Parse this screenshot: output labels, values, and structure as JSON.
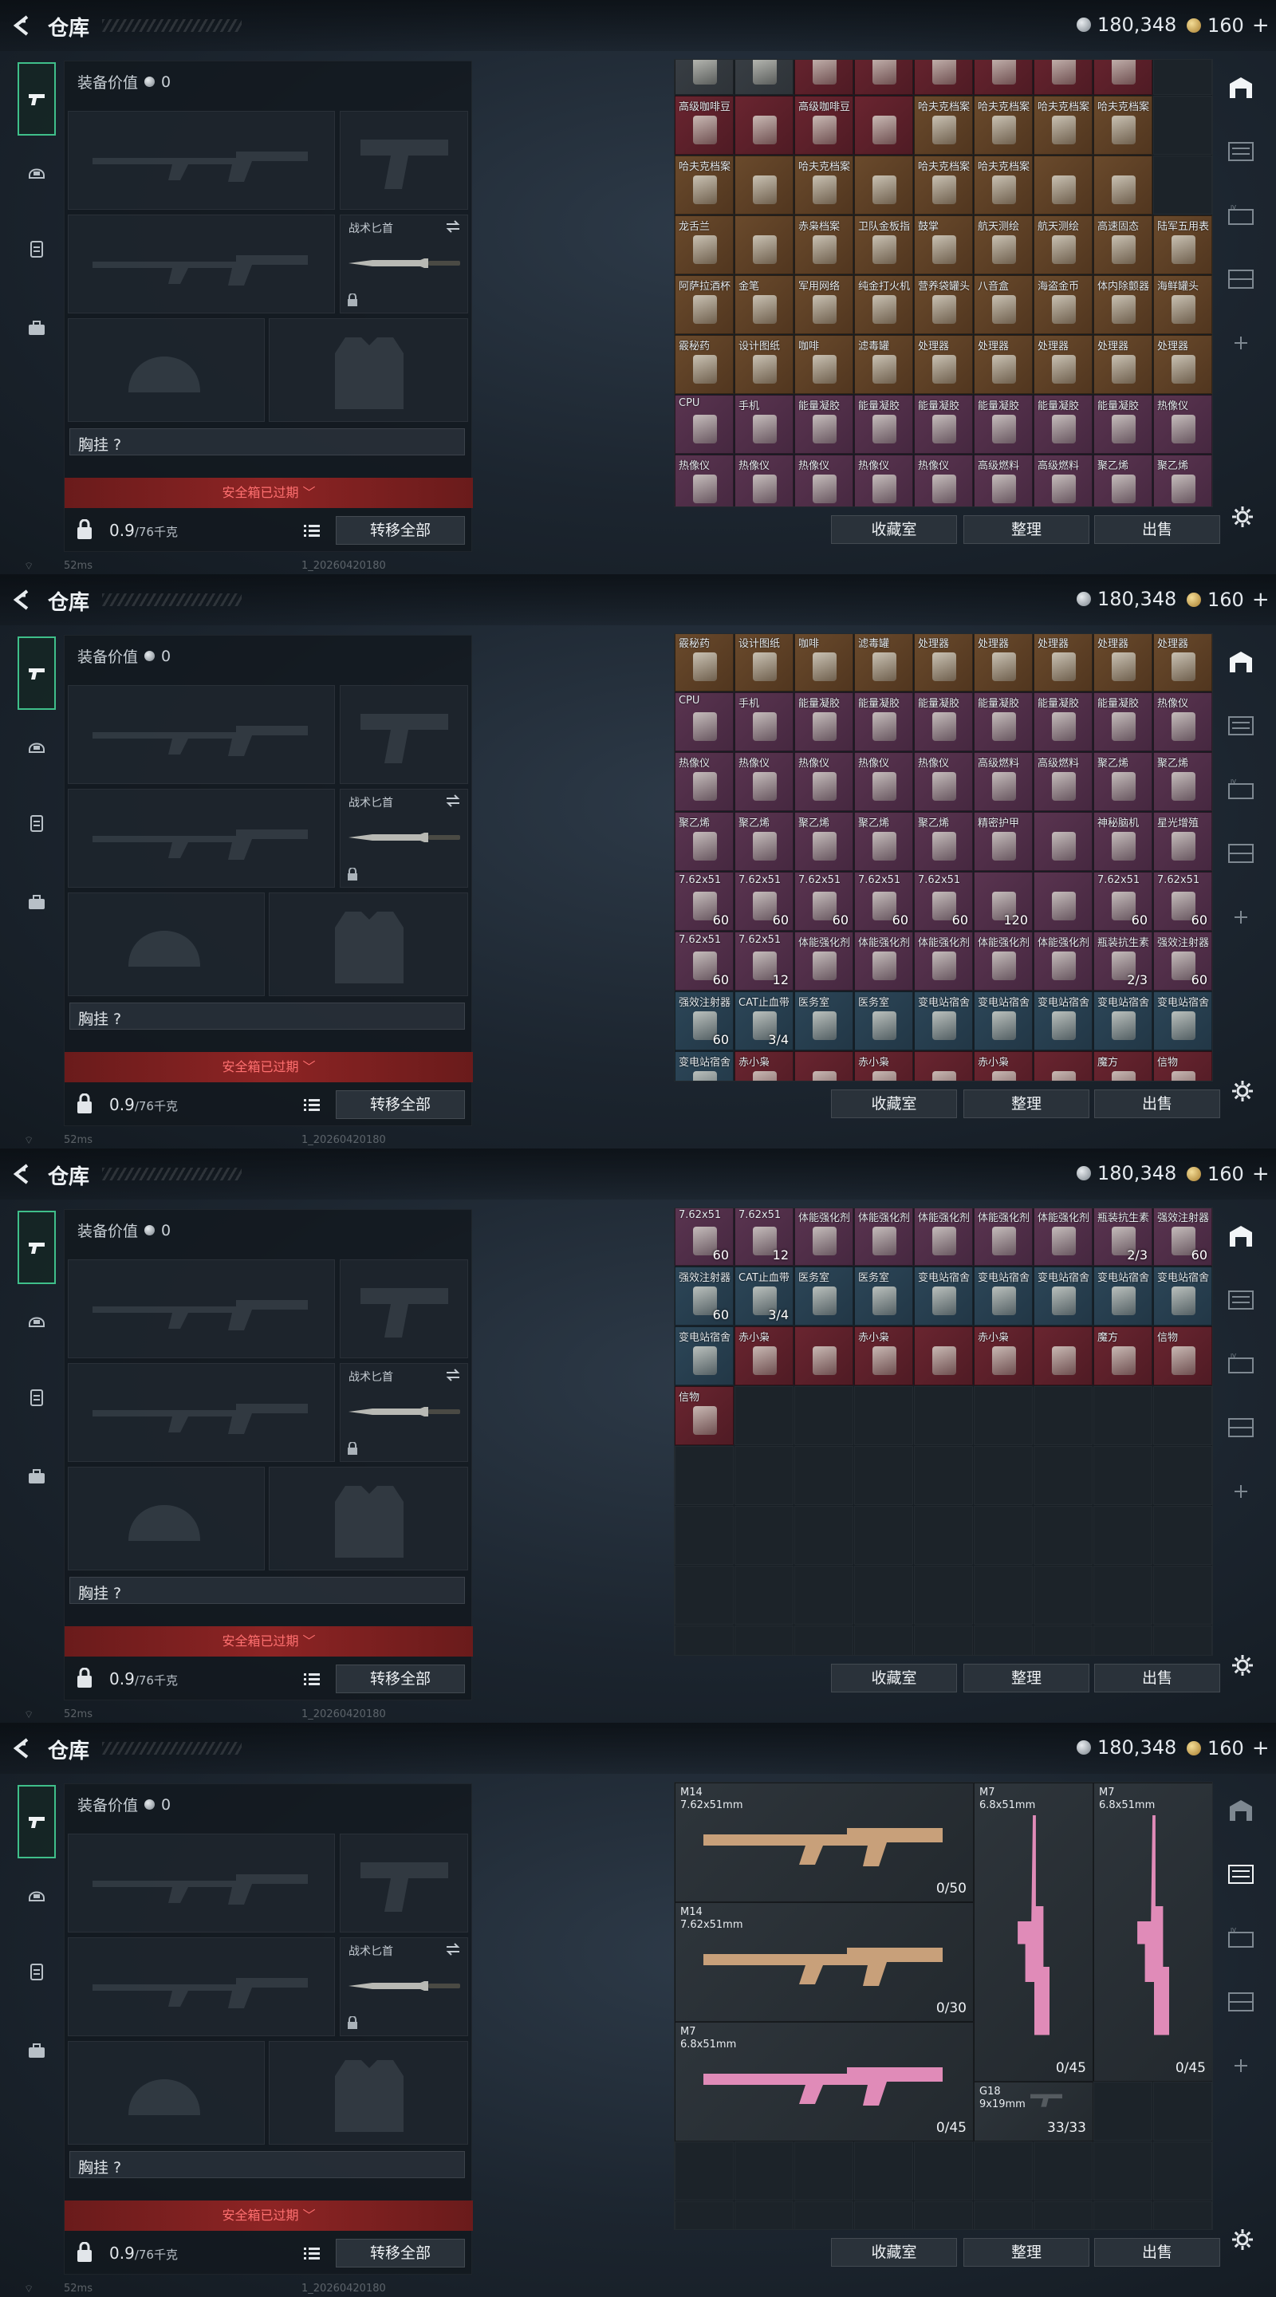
{
  "header": {
    "title": "仓库",
    "silver": "180,348",
    "gold": "160",
    "plus": "+"
  },
  "equipment": {
    "value_label": "装备价值",
    "value": "0",
    "knife_label": "战术匕首",
    "chest_label": "胸挂 ?",
    "safebox_expired": "安全箱已过期",
    "weight": "0.9",
    "weight_cap": "/76千克",
    "transfer_all": "转移全部"
  },
  "actions": {
    "collection": "收藏室",
    "organize": "整理",
    "sell": "出售"
  },
  "status_bar": {
    "ping": "52ms",
    "build": "1_20260420180"
  },
  "panel1_rows": [
    [
      {
        "l": "",
        "r": "grey"
      },
      {
        "l": "",
        "r": "grey"
      },
      {
        "l": "",
        "r": "red"
      },
      {
        "l": "",
        "r": "red"
      },
      {
        "l": "",
        "r": "red"
      },
      {
        "l": "",
        "r": "red"
      },
      {
        "l": "",
        "r": "red"
      },
      {
        "l": "",
        "r": "red"
      }
    ],
    [
      {
        "l": "高级咖啡豆",
        "r": "red"
      },
      {
        "l": "",
        "r": "red"
      },
      {
        "l": "高级咖啡豆",
        "r": "red"
      },
      {
        "l": "",
        "r": "red"
      },
      {
        "l": "哈夫克档案",
        "r": "orange"
      },
      {
        "l": "哈夫克档案",
        "r": "orange"
      },
      {
        "l": "哈夫克档案",
        "r": "orange"
      },
      {
        "l": "哈夫克档案",
        "r": "orange"
      }
    ],
    [
      {
        "l": "哈夫克档案",
        "r": "orange"
      },
      {
        "l": "",
        "r": "orange"
      },
      {
        "l": "哈夫克档案",
        "r": "orange"
      },
      {
        "l": "",
        "r": "orange"
      },
      {
        "l": "哈夫克档案",
        "r": "orange"
      },
      {
        "l": "哈夫克档案",
        "r": "orange"
      },
      {
        "l": "",
        "r": "orange"
      },
      {
        "l": "",
        "r": "orange"
      }
    ],
    [
      {
        "l": "龙舌兰",
        "r": "orange"
      },
      {
        "l": "",
        "r": "orange"
      },
      {
        "l": "赤枭档案",
        "r": "orange"
      },
      {
        "l": "卫队金板指",
        "r": "orange"
      },
      {
        "l": "鼓掌",
        "r": "orange"
      },
      {
        "l": "航天测绘",
        "r": "orange"
      },
      {
        "l": "航天测绘",
        "r": "orange"
      },
      {
        "l": "高速固态",
        "r": "orange"
      },
      {
        "l": "陆军五用表",
        "r": "orange"
      }
    ],
    [
      {
        "l": "阿萨拉酒杯",
        "r": "orange"
      },
      {
        "l": "金笔",
        "r": "orange"
      },
      {
        "l": "军用网络",
        "r": "orange"
      },
      {
        "l": "纯金打火机",
        "r": "orange"
      },
      {
        "l": "营养袋罐头",
        "r": "orange"
      },
      {
        "l": "八音盒",
        "r": "orange"
      },
      {
        "l": "海盗金币",
        "r": "orange"
      },
      {
        "l": "体内除颤器",
        "r": "orange"
      },
      {
        "l": "海鲜罐头",
        "r": "orange"
      }
    ],
    [
      {
        "l": "霰秘药",
        "r": "orange"
      },
      {
        "l": "设计图纸",
        "r": "orange"
      },
      {
        "l": "咖啡",
        "r": "orange"
      },
      {
        "l": "滤毒罐",
        "r": "orange"
      },
      {
        "l": "处理器",
        "r": "orange"
      },
      {
        "l": "处理器",
        "r": "orange"
      },
      {
        "l": "处理器",
        "r": "orange"
      },
      {
        "l": "处理器",
        "r": "orange"
      },
      {
        "l": "处理器",
        "r": "orange"
      }
    ],
    [
      {
        "l": "CPU",
        "r": "purple"
      },
      {
        "l": "手机",
        "r": "purple"
      },
      {
        "l": "能量凝胶",
        "r": "purple"
      },
      {
        "l": "能量凝胶",
        "r": "purple"
      },
      {
        "l": "能量凝胶",
        "r": "purple"
      },
      {
        "l": "能量凝胶",
        "r": "purple"
      },
      {
        "l": "能量凝胶",
        "r": "purple"
      },
      {
        "l": "能量凝胶",
        "r": "purple"
      },
      {
        "l": "热像仪",
        "r": "purple"
      }
    ],
    [
      {
        "l": "热像仪",
        "r": "purple"
      },
      {
        "l": "热像仪",
        "r": "purple"
      },
      {
        "l": "热像仪",
        "r": "purple"
      },
      {
        "l": "热像仪",
        "r": "purple"
      },
      {
        "l": "热像仪",
        "r": "purple"
      },
      {
        "l": "高级燃料",
        "r": "purple"
      },
      {
        "l": "高级燃料",
        "r": "purple"
      },
      {
        "l": "聚乙烯",
        "r": "purple"
      },
      {
        "l": "聚乙烯",
        "r": "purple"
      }
    ]
  ],
  "panel2_rows": [
    [
      {
        "l": "霰秘药",
        "r": "orange"
      },
      {
        "l": "设计图纸",
        "r": "orange"
      },
      {
        "l": "咖啡",
        "r": "orange"
      },
      {
        "l": "滤毒罐",
        "r": "orange"
      },
      {
        "l": "处理器",
        "r": "orange"
      },
      {
        "l": "处理器",
        "r": "orange"
      },
      {
        "l": "处理器",
        "r": "orange"
      },
      {
        "l": "处理器",
        "r": "orange"
      },
      {
        "l": "处理器",
        "r": "orange"
      }
    ],
    [
      {
        "l": "CPU",
        "r": "purple"
      },
      {
        "l": "手机",
        "r": "purple"
      },
      {
        "l": "能量凝胶",
        "r": "purple"
      },
      {
        "l": "能量凝胶",
        "r": "purple"
      },
      {
        "l": "能量凝胶",
        "r": "purple"
      },
      {
        "l": "能量凝胶",
        "r": "purple"
      },
      {
        "l": "能量凝胶",
        "r": "purple"
      },
      {
        "l": "能量凝胶",
        "r": "purple"
      },
      {
        "l": "热像仪",
        "r": "purple"
      }
    ],
    [
      {
        "l": "热像仪",
        "r": "purple"
      },
      {
        "l": "热像仪",
        "r": "purple"
      },
      {
        "l": "热像仪",
        "r": "purple"
      },
      {
        "l": "热像仪",
        "r": "purple"
      },
      {
        "l": "热像仪",
        "r": "purple"
      },
      {
        "l": "高级燃料",
        "r": "purple"
      },
      {
        "l": "高级燃料",
        "r": "purple"
      },
      {
        "l": "聚乙烯",
        "r": "purple"
      },
      {
        "l": "聚乙烯",
        "r": "purple"
      }
    ],
    [
      {
        "l": "聚乙烯",
        "r": "purple"
      },
      {
        "l": "聚乙烯",
        "r": "purple"
      },
      {
        "l": "聚乙烯",
        "r": "purple"
      },
      {
        "l": "聚乙烯",
        "r": "purple"
      },
      {
        "l": "聚乙烯",
        "r": "purple"
      },
      {
        "l": "精密护甲",
        "r": "purple"
      },
      {
        "l": "",
        "r": "purple"
      },
      {
        "l": "神秘脑机",
        "r": "purple"
      },
      {
        "l": "星光增殖",
        "r": "purple"
      }
    ],
    [
      {
        "l": "7.62x51",
        "r": "purple",
        "q": "60"
      },
      {
        "l": "7.62x51",
        "r": "purple",
        "q": "60"
      },
      {
        "l": "7.62x51",
        "r": "purple",
        "q": "60"
      },
      {
        "l": "7.62x51",
        "r": "purple",
        "q": "60"
      },
      {
        "l": "7.62x51",
        "r": "purple",
        "q": "60"
      },
      {
        "l": "",
        "r": "purple",
        "q": "120"
      },
      {
        "l": "",
        "r": "purple"
      },
      {
        "l": "7.62x51",
        "r": "purple",
        "q": "60"
      },
      {
        "l": "7.62x51",
        "r": "purple",
        "q": "60"
      }
    ],
    [
      {
        "l": "7.62x51",
        "r": "purple",
        "q": "60"
      },
      {
        "l": "7.62x51",
        "r": "purple",
        "q": "12"
      },
      {
        "l": "体能强化剂",
        "r": "purple"
      },
      {
        "l": "体能强化剂",
        "r": "purple"
      },
      {
        "l": "体能强化剂",
        "r": "purple"
      },
      {
        "l": "体能强化剂",
        "r": "purple"
      },
      {
        "l": "体能强化剂",
        "r": "purple"
      },
      {
        "l": "瓶装抗生素",
        "r": "purple",
        "q": "2/3"
      },
      {
        "l": "强效注射器",
        "r": "purple",
        "q": "60"
      }
    ],
    [
      {
        "l": "强效注射器",
        "r": "blue",
        "q": "60"
      },
      {
        "l": "CAT止血带",
        "r": "blue",
        "q": "3/4"
      },
      {
        "l": "医务室",
        "r": "blue"
      },
      {
        "l": "医务室",
        "r": "blue"
      },
      {
        "l": "变电站宿舍",
        "r": "blue"
      },
      {
        "l": "变电站宿舍",
        "r": "blue"
      },
      {
        "l": "变电站宿舍",
        "r": "blue"
      },
      {
        "l": "变电站宿舍",
        "r": "blue"
      },
      {
        "l": "变电站宿舍",
        "r": "blue"
      }
    ],
    [
      {
        "l": "变电站宿舍",
        "r": "blue"
      },
      {
        "l": "赤小枭",
        "r": "red"
      },
      {
        "l": "",
        "r": "red"
      },
      {
        "l": "赤小枭",
        "r": "red"
      },
      {
        "l": "",
        "r": "red"
      },
      {
        "l": "赤小枭",
        "r": "red"
      },
      {
        "l": "",
        "r": "red"
      },
      {
        "l": "魔方",
        "r": "red"
      },
      {
        "l": "信物",
        "r": "red"
      }
    ]
  ],
  "panel3_rows": [
    [
      {
        "l": "7.62x51",
        "r": "purple",
        "q": "60"
      },
      {
        "l": "7.62x51",
        "r": "purple",
        "q": "12"
      },
      {
        "l": "体能强化剂",
        "r": "purple"
      },
      {
        "l": "体能强化剂",
        "r": "purple"
      },
      {
        "l": "体能强化剂",
        "r": "purple"
      },
      {
        "l": "体能强化剂",
        "r": "purple"
      },
      {
        "l": "体能强化剂",
        "r": "purple"
      },
      {
        "l": "瓶装抗生素",
        "r": "purple",
        "q": "2/3"
      },
      {
        "l": "强效注射器",
        "r": "purple",
        "q": "60"
      }
    ],
    [
      {
        "l": "强效注射器",
        "r": "blue",
        "q": "60"
      },
      {
        "l": "CAT止血带",
        "r": "blue",
        "q": "3/4"
      },
      {
        "l": "医务室",
        "r": "blue"
      },
      {
        "l": "医务室",
        "r": "blue"
      },
      {
        "l": "变电站宿舍",
        "r": "blue"
      },
      {
        "l": "变电站宿舍",
        "r": "blue"
      },
      {
        "l": "变电站宿舍",
        "r": "blue"
      },
      {
        "l": "变电站宿舍",
        "r": "blue"
      },
      {
        "l": "变电站宿舍",
        "r": "blue"
      }
    ],
    [
      {
        "l": "变电站宿舍",
        "r": "blue"
      },
      {
        "l": "赤小枭",
        "r": "red"
      },
      {
        "l": "",
        "r": "red"
      },
      {
        "l": "赤小枭",
        "r": "red"
      },
      {
        "l": "",
        "r": "red"
      },
      {
        "l": "赤小枭",
        "r": "red"
      },
      {
        "l": "",
        "r": "red"
      },
      {
        "l": "魔方",
        "r": "red"
      },
      {
        "l": "信物",
        "r": "red"
      }
    ],
    [
      {
        "l": "信物",
        "r": "red"
      }
    ]
  ],
  "weapons": [
    {
      "name": "M14",
      "cal": "7.62x51mm",
      "ammo": "0/50"
    },
    {
      "name": "M7",
      "cal": "6.8x51mm",
      "ammo": "0/45"
    },
    {
      "name": "M7",
      "cal": "6.8x51mm",
      "ammo": "0/45"
    },
    {
      "name": "M14",
      "cal": "7.62x51mm",
      "ammo": "0/30"
    },
    {
      "name": "M7",
      "cal": "6.8x51mm",
      "ammo": "0/45"
    },
    {
      "name": "G18",
      "cal": "9x19mm",
      "ammo": "33/33"
    }
  ],
  "colors": {
    "accent_green": "#3fbf8a",
    "expired_red": "#8d2424",
    "rarity_orange": "#6a4a2c",
    "rarity_purple": "#5a3450",
    "rarity_red": "#6a2530",
    "rarity_blue": "#2c4658"
  },
  "icons": {
    "back": "back-chevron-icon",
    "coin_silver": "silver-coin-icon",
    "coin_gold": "gold-coin-icon",
    "tabs": [
      "pistol-icon",
      "helmet-icon",
      "vest-icon",
      "briefcase-icon"
    ],
    "rightbar": [
      "storage-icon",
      "rack-icon",
      "iv-icon",
      "shelf-icon",
      "plus-icon"
    ],
    "settings": "gear-icon"
  }
}
